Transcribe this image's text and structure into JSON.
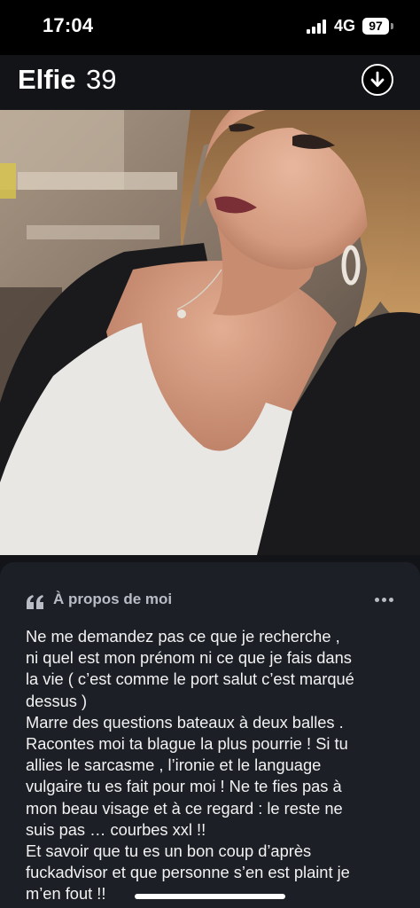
{
  "status_bar": {
    "time": "17:04",
    "network": "4G",
    "battery": "97",
    "icons": [
      "cellular-signal-icon",
      "battery-icon"
    ]
  },
  "profile": {
    "name": "Elfie",
    "age": "39",
    "photo_description_icon": "profile-photo",
    "download_icon": "arrow-down-circle-icon"
  },
  "about": {
    "title": "À propos de moi",
    "icon": "quote-icon",
    "menu_icon": "more-horizontal-icon",
    "text": "Ne me demandez pas ce que je recherche ,\nni quel est mon prénom ni ce que je fais dans\nla vie ( c’est comme le port salut c’est marqué\ndessus )\nMarre des questions bateaux à deux balles .\nRacontes moi ta blague la plus pourrie ! Si tu\nallies le sarcasme , l’ironie et le language\nvulgaire tu es fait pour moi ! Ne te fies pas à\nmon beau visage et à ce regard : le reste ne\nsuis pas … courbes xxl !!\nEt savoir que tu es un bon coup d’après\nfuckadvisor et que personne s’en est plaint je\nm’en fout !!"
  },
  "colors": {
    "background": "#121418",
    "card": "#1c1f26",
    "secondary_text": "#b9bcc4",
    "text": "#f2f2f2"
  }
}
